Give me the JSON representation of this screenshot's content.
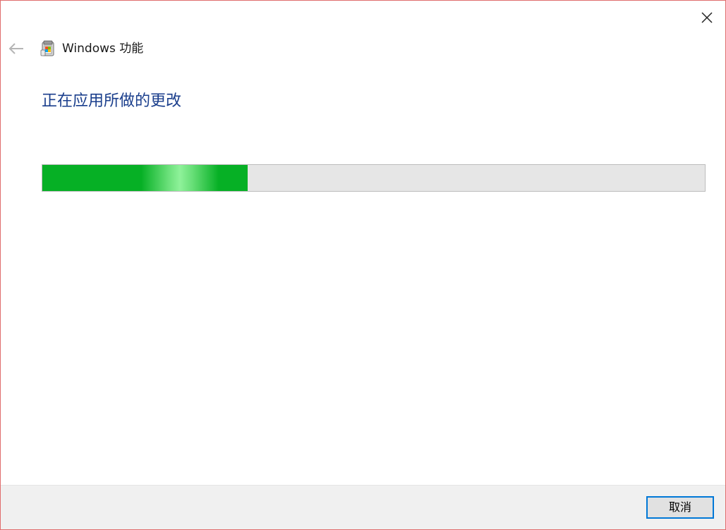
{
  "window": {
    "title": "Windows 功能"
  },
  "icons": {
    "back": "back-arrow-icon",
    "app": "windows-features-icon",
    "close": "close-icon"
  },
  "main": {
    "heading": "正在应用所做的更改"
  },
  "progress": {
    "value": 0.31,
    "fill_color": "#06b025",
    "track_color": "#e6e6e6"
  },
  "footer": {
    "cancel_label": "取消"
  },
  "colors": {
    "heading": "#1a3e8c",
    "accent": "#0078d7",
    "window_border": "#e06d6d"
  }
}
